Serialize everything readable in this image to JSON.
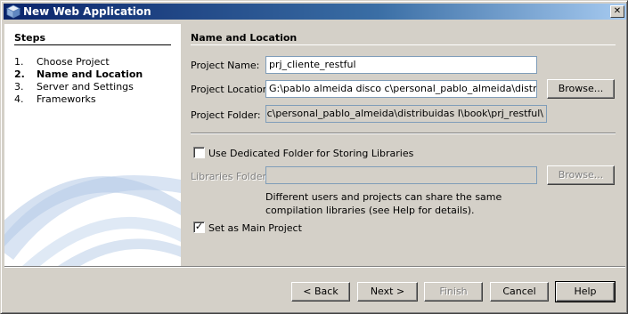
{
  "window": {
    "title": "New Web Application"
  },
  "steps": {
    "heading": "Steps",
    "items": [
      {
        "num": "1.",
        "label": "Choose Project"
      },
      {
        "num": "2.",
        "label": "Name and Location"
      },
      {
        "num": "3.",
        "label": "Server and Settings"
      },
      {
        "num": "4.",
        "label": "Frameworks"
      }
    ]
  },
  "main": {
    "section_title": "Name and Location",
    "project_name_label": "Project Name:",
    "project_name_value": "prj_cliente_restful",
    "project_location_label": "Project Location:",
    "project_location_value": "G:\\pablo almeida disco c\\personal_pablo_almeida\\distribuidas I",
    "browse_label": "Browse...",
    "project_folder_label": "Project Folder:",
    "project_folder_value": "a disco c\\personal_pablo_almeida\\distribuidas I\\book\\prj_restful\\",
    "dedicated_folder_label": "Use Dedicated Folder for Storing Libraries",
    "dedicated_folder_checked": false,
    "libraries_folder_label": "Libraries Folder:",
    "libraries_folder_value": "",
    "libraries_browse_label": "Browse...",
    "help_text": "Different users and projects can share the same compilation libraries (see Help for details).",
    "main_project_label": "Set as Main Project",
    "main_project_checked": true
  },
  "footer": {
    "back_label": "< Back",
    "next_label": "Next >",
    "finish_label": "Finish",
    "cancel_label": "Cancel",
    "help_label": "Help"
  },
  "colors": {
    "titlebar_start": "#0a246a",
    "titlebar_end": "#a6caf0",
    "dialog_bg": "#d4d0c8",
    "steps_bg": "#ffffff"
  },
  "icons": {
    "app": "netbeans-cube-icon",
    "close": "close-icon",
    "check": "check-icon"
  }
}
